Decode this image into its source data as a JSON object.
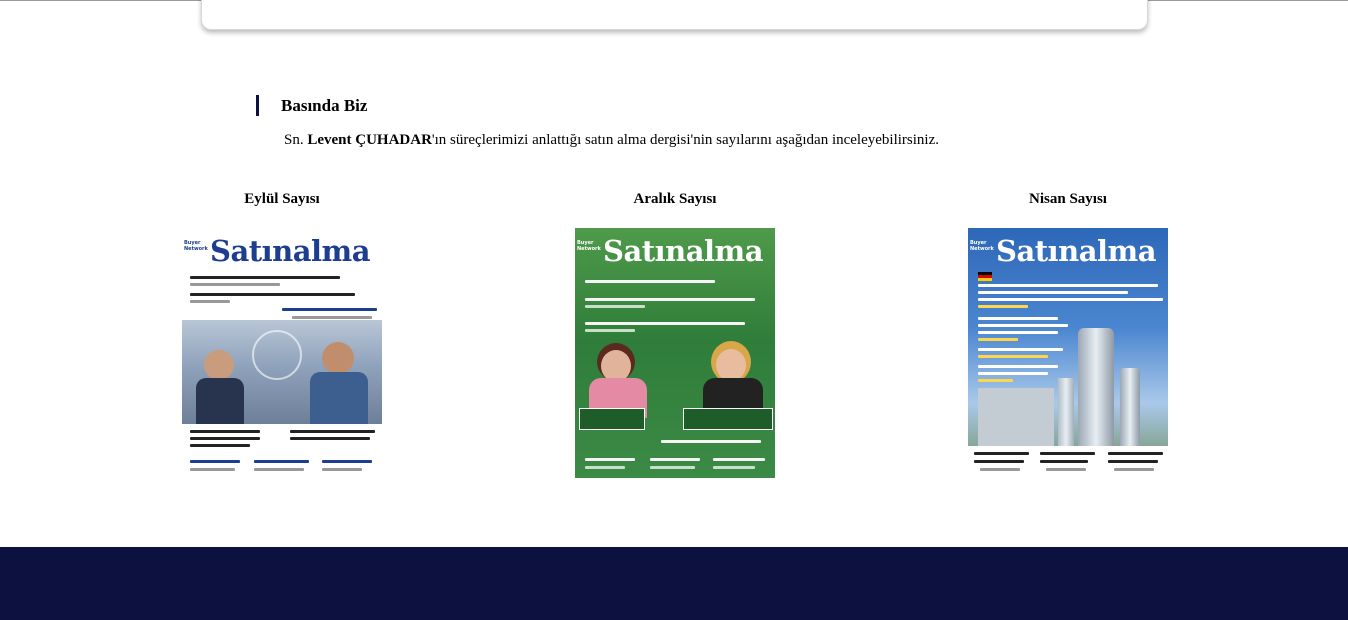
{
  "section": {
    "title": "Basında Biz",
    "intro_prefix": "Sn. ",
    "intro_name": "Levent ÇUHADAR",
    "intro_suffix": "'ın süreçlerimizi anlattığı satın alma dergisi'nin sayılarını aşağıdan inceleyebilirsiniz."
  },
  "issues": [
    {
      "title": "Eylül Sayısı",
      "cover_brand": "Satınalma"
    },
    {
      "title": "Aralık Sayısı",
      "cover_brand": "Satınalma"
    },
    {
      "title": "Nisan Sayısı",
      "cover_brand": "Satınalma"
    }
  ],
  "colors": {
    "footer": "#0c1140",
    "accent_bar": "#0c1140",
    "cover_green": "#2f7d3a",
    "cover_blue": "#2f6fc0"
  }
}
